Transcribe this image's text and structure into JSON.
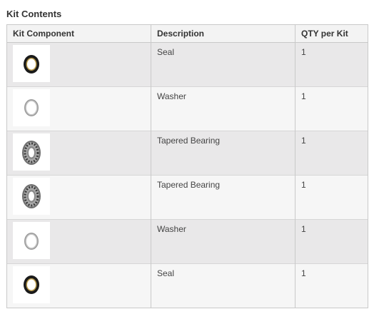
{
  "section": {
    "title": "Kit Contents"
  },
  "table": {
    "headers": [
      "Kit Component",
      "Description",
      "QTY per Kit"
    ],
    "rows": [
      {
        "icon": "seal-icon",
        "description": "Seal",
        "qty": "1"
      },
      {
        "icon": "washer-icon",
        "description": "Washer",
        "qty": "1"
      },
      {
        "icon": "tapered-bearing-icon",
        "description": "Tapered Bearing",
        "qty": "1"
      },
      {
        "icon": "tapered-bearing-icon",
        "description": "Tapered Bearing",
        "qty": "1"
      },
      {
        "icon": "washer-icon",
        "description": "Washer",
        "qty": "1"
      },
      {
        "icon": "seal-icon",
        "description": "Seal",
        "qty": "1"
      }
    ]
  }
}
